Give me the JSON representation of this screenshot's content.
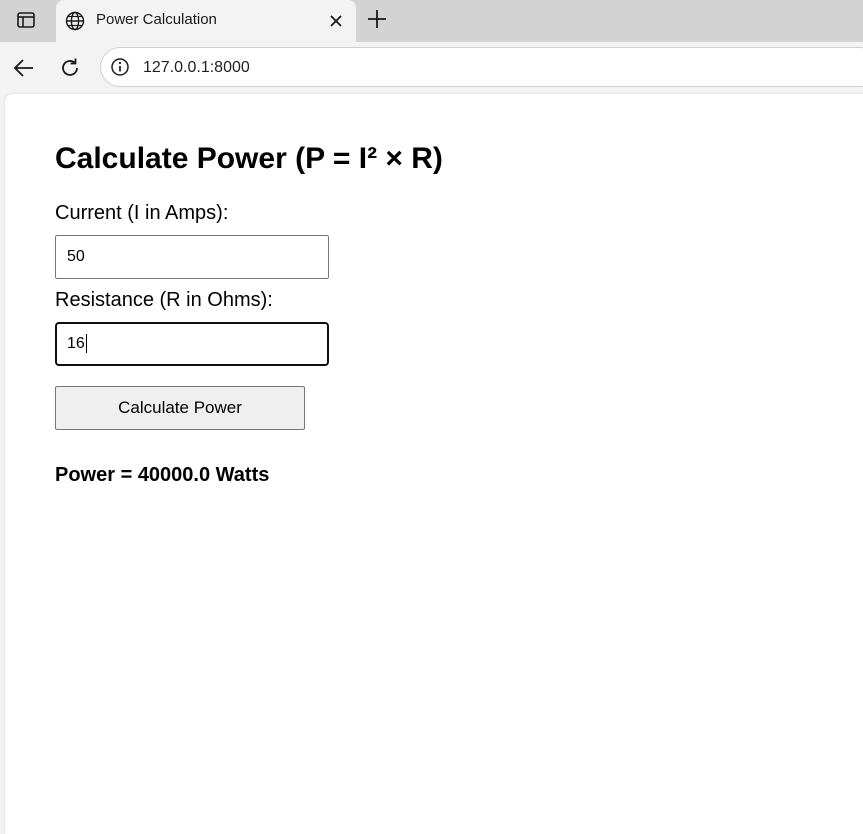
{
  "browser": {
    "tab_title": "Power Calculation",
    "url": "127.0.0.1:8000"
  },
  "page": {
    "heading": "Calculate Power (P = I² × R)",
    "current_label": "Current (I in Amps):",
    "current_value": "50",
    "resistance_label": "Resistance (R in Ohms):",
    "resistance_value": "16",
    "button_label": "Calculate Power",
    "result_text": "Power = 40000.0 Watts"
  }
}
